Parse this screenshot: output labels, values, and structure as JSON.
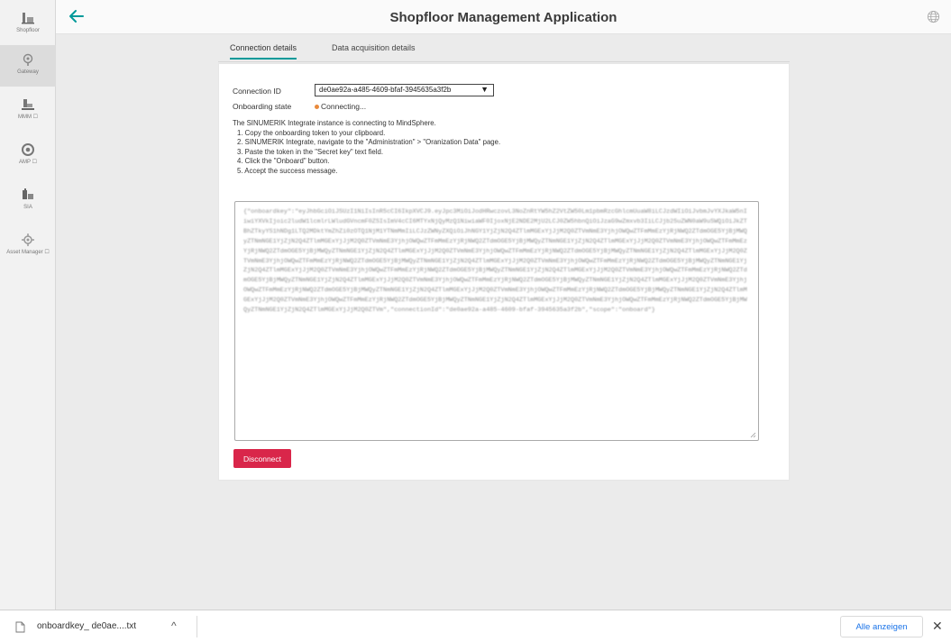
{
  "header": {
    "title": "Shopfloor Management Application",
    "back_icon": "arrow-left-icon",
    "globe_icon": "globe-icon"
  },
  "sidebar": {
    "items": [
      {
        "label": "Shopfloor",
        "icon": "shopfloor-icon",
        "active": false
      },
      {
        "label": "Gateway",
        "icon": "gateway-icon",
        "active": true
      },
      {
        "label": "MMM ☐",
        "icon": "mmm-icon",
        "active": false
      },
      {
        "label": "AMP ☐",
        "icon": "amp-icon",
        "active": false
      },
      {
        "label": "SIA",
        "icon": "sia-icon",
        "active": false
      },
      {
        "label": "Asset Manager ☐",
        "icon": "asset-manager-icon",
        "active": false
      }
    ]
  },
  "tabs": [
    {
      "label": "Connection details",
      "active": true
    },
    {
      "label": "Data acquisition details",
      "active": false
    }
  ],
  "connection": {
    "id_label": "Connection ID",
    "id_value": "de0ae92a-a485-4609-bfaf-3945635a3f2b",
    "state_label": "Onboarding state",
    "state_value": "Connecting...",
    "state_color": "#e98a3c",
    "intro": "The SINUMERIK Integrate instance is connecting to MindSphere.",
    "steps": [
      "1. Copy the onboarding token to your clipboard.",
      "2. SINUMERIK Integrate, navigate to the \"Administration\" > \"Oranization Data\" page.",
      "3. Paste the token in the \"Secret key\" text field.",
      "4. Click the \"Onboard\" button.",
      "5. Accept the success message."
    ],
    "token_text": "{\"onboardkey\":\"eyJhbGciOiJSUzI1NiIsInR5cCI6IkpXVCJ9.eyJpc3MiOiJodHRwczovL3NoZnRtYW5hZ2VtZW50Lm1pbmRzcGhlcmUuaW8iLCJzdWIiOiJvbmJvYXJkaW5nIiwiYXVkIjoic2ludW1lcmlrLWludGVncmF0ZSIsImV4cCI6MTYxNjQyMzQ1NiwiaWF0IjoxNjE2NDE2MjU2LCJ0ZW5hbnQiOiJzaG9wZmxvb3IiLCJjb25uZWN0aW9uSWQiOiJkZTBhZTkyYS1hNDg1LTQ2MDktYmZhZi0zOTQ1NjM1YTNmMmIiLCJzZWNyZXQiOiJhNGY1YjZjN2Q4ZTlmMGExYjJjM2Q0ZTVmNmE3YjhjOWQwZTFmMmEzYjRjNWQ2ZTdmOGE5YjBjMWQyZTNmNGE1YjZjN2Q4ZTlmMGExYjJjM2Q0ZTVmNmE3YjhjOWQwZTFmMmEzYjRjNWQ2ZTdmOGE5YjBjMWQyZTNmNGE1YjZjN2Q4ZTlmMGExYjJjM2Q0ZTVmNmE3YjhjOWQwZTFmMmEzYjRjNWQ2ZTdmOGE5YjBjMWQyZTNmNGE1YjZjN2Q4ZTlmMGExYjJjM2Q0ZTVmNmE3YjhjOWQwZTFmMmEzYjRjNWQ2ZTdmOGE5YjBjMWQyZTNmNGE1YjZjN2Q4ZTlmMGExYjJjM2Q0ZTVmNmE3YjhjOWQwZTFmMmEzYjRjNWQ2ZTdmOGE5YjBjMWQyZTNmNGE1YjZjN2Q4ZTlmMGExYjJjM2Q0ZTVmNmE3YjhjOWQwZTFmMmEzYjRjNWQ2ZTdmOGE5YjBjMWQyZTNmNGE1YjZjN2Q4ZTlmMGExYjJjM2Q0ZTVmNmE3YjhjOWQwZTFmMmEzYjRjNWQ2ZTdmOGE5YjBjMWQyZTNmNGE1YjZjN2Q4ZTlmMGExYjJjM2Q0ZTVmNmE3YjhjOWQwZTFmMmEzYjRjNWQ2ZTdmOGE5YjBjMWQyZTNmNGE1YjZjN2Q4ZTlmMGExYjJjM2Q0ZTVmNmE3YjhjOWQwZTFmMmEzYjRjNWQ2ZTdmOGE5YjBjMWQyZTNmNGE1YjZjN2Q4ZTlmMGExYjJjM2Q0ZTVmNmE3YjhjOWQwZTFmMmEzYjRjNWQ2ZTdmOGE5YjBjMWQyZTNmNGE1YjZjN2Q4ZTlmMGExYjJjM2Q0ZTVmNmE3YjhjOWQwZTFmMmEzYjRjNWQ2ZTdmOGE5YjBjMWQyZTNmNGE1YjZjN2Q4ZTlmMGExYjJjM2Q0ZTVmNmE3YjhjOWQwZTFmMmEzYjRjNWQ2ZTdmOGE5YjBjMWQyZTNmNGE1YjZjN2Q4ZTlmMGExYjJjM2Q0ZTVmNmE3YjhjOWQwZTFmMmEzYjRjNWQ2ZTdmOGE5YjBjMWQyZTNmNGE1YjZjN2Q4ZTlmMGExYjJjM2Q0ZTVm\",\"connectionId\":\"de0ae92a-a485-4609-bfaf-3945635a3f2b\",\"scope\":\"onboard\"}",
    "disconnect_label": "Disconnect",
    "disconnect_color": "#d9264a"
  },
  "download_bar": {
    "file_name": "onboardkey_ de0ae....txt",
    "file_icon": "file-icon",
    "chevron_icon": "chevron-up-icon",
    "show_all_label": "Alle anzeigen",
    "close_icon": "close-icon"
  },
  "accent_color": "#009999"
}
